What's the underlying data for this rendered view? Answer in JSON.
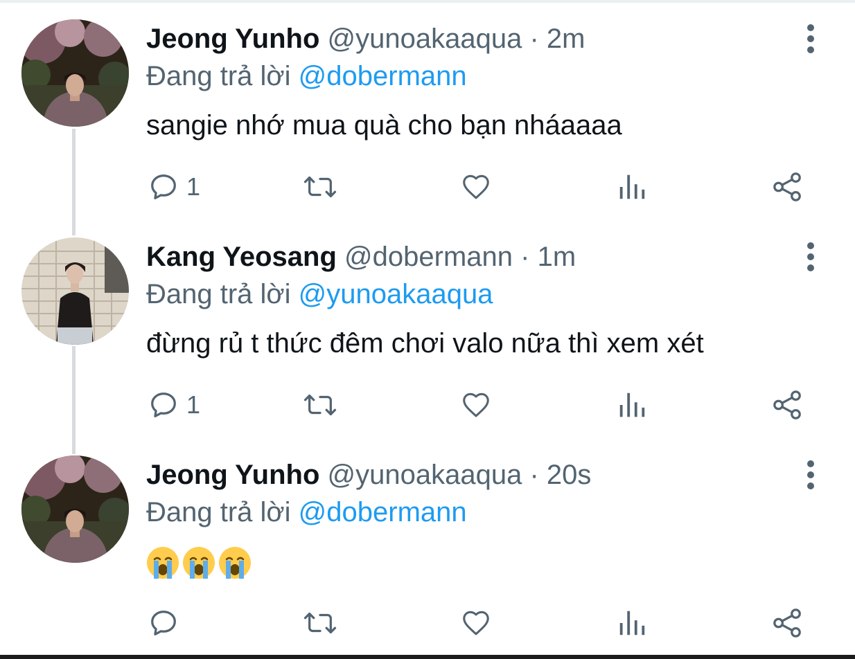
{
  "tweets": [
    {
      "name": "Jeong Yunho",
      "handle": "@yunoakaaqua",
      "separator": "·",
      "time": "2m",
      "reply_prefix": "Đang trả lời",
      "reply_to": "@dobermann",
      "text": "sangie nhớ mua quà cho bạn nháaaaa",
      "reply_count": "1"
    },
    {
      "name": "Kang Yeosang",
      "handle": "@dobermann",
      "separator": "·",
      "time": "1m",
      "reply_prefix": "Đang trả lời",
      "reply_to": "@yunoakaaqua",
      "text": "đừng rủ t thức đêm chơi valo nữa thì xem xét",
      "reply_count": "1"
    },
    {
      "name": "Jeong Yunho",
      "handle": "@yunoakaaqua",
      "separator": "·",
      "time": "20s",
      "reply_prefix": "Đang trả lời",
      "reply_to": "@dobermann",
      "text": "😭😭😭",
      "reply_count": ""
    }
  ],
  "icons": {
    "reply": "reply-icon",
    "retweet": "retweet-icon",
    "like": "heart-icon",
    "views": "views-icon",
    "share": "share-icon",
    "more": "more-vertical-icon",
    "emoji": "loudly-crying-face-emoji"
  },
  "colors": {
    "text": "#0f1419",
    "secondary": "#536471",
    "mention": "#1d9bf0",
    "thread_line": "#d7dbdf"
  }
}
